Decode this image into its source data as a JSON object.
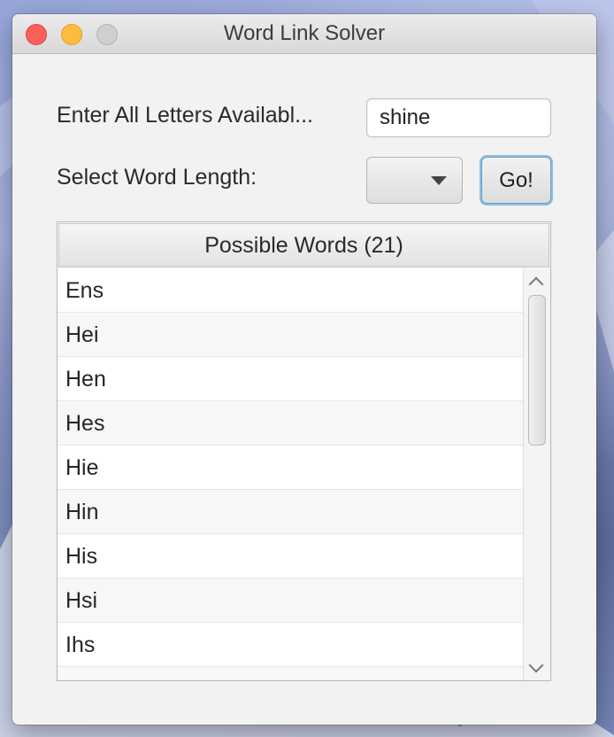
{
  "window": {
    "title": "Word Link Solver"
  },
  "form": {
    "letters_label": "Enter All Letters Availabl...",
    "letters_value": "shine",
    "length_label": "Select Word Length:",
    "length_selected": "",
    "go_label": "Go!"
  },
  "results": {
    "header": "Possible Words (21)",
    "visible_words": [
      "Ens",
      "Hei",
      "Hen",
      "Hes",
      "Hie",
      "Hin",
      "His",
      "Hsi",
      "Ihs",
      ""
    ]
  },
  "colors": {
    "close": "#fc605c",
    "minimize": "#fdbc40",
    "zoom_disabled": "#cfcfcf",
    "focus_ring": "#7fc2ef",
    "window_bg": "#f2f2f2"
  },
  "icons": {
    "select": "chevron-down-icon",
    "scroll_up": "chevron-up-icon",
    "scroll_down": "chevron-down-icon"
  }
}
